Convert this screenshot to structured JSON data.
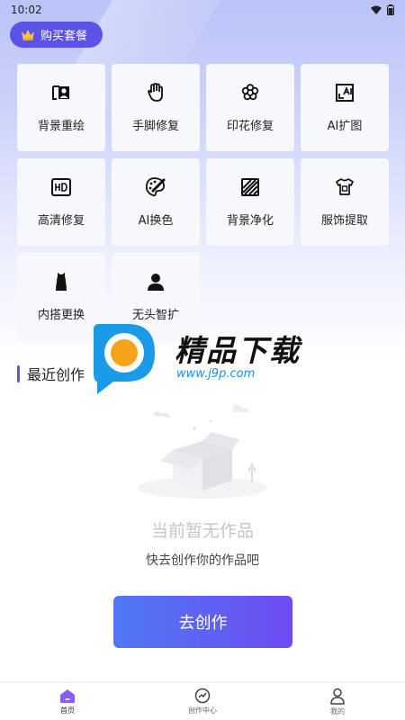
{
  "status_bar": {
    "time": "10:02"
  },
  "header": {
    "buy_label": "购买套餐"
  },
  "tools": [
    {
      "label": "背景重绘",
      "icon": "person-frame-icon"
    },
    {
      "label": "手脚修复",
      "icon": "hand-icon"
    },
    {
      "label": "印花修复",
      "icon": "flower-icon"
    },
    {
      "label": "AI扩图",
      "icon": "ai-expand-icon"
    },
    {
      "label": "高清修复",
      "icon": "hd-icon"
    },
    {
      "label": "AI换色",
      "icon": "palette-icon"
    },
    {
      "label": "背景净化",
      "icon": "stripes-icon"
    },
    {
      "label": "服饰提取",
      "icon": "shirt-icon"
    },
    {
      "label": "内搭更换",
      "icon": "tank-top-icon"
    },
    {
      "label": "无头智扩",
      "icon": "headless-person-icon"
    }
  ],
  "recent": {
    "title": "最近创作"
  },
  "watermark": {
    "brand": "精品下载",
    "url": "www.j9p.com"
  },
  "empty": {
    "title": "当前暂无作品",
    "subtitle": "快去创作你的作品吧",
    "button_label": "去创作"
  },
  "tabbar": [
    {
      "label": "首页",
      "icon": "home-icon",
      "active": true
    },
    {
      "label": "创作中心",
      "icon": "creation-center-icon",
      "active": false
    },
    {
      "label": "我的",
      "icon": "user-icon",
      "active": false
    }
  ],
  "colors": {
    "accent": "#5b52e8",
    "button_start": "#4f79f4",
    "button_end": "#6e4cf2"
  }
}
